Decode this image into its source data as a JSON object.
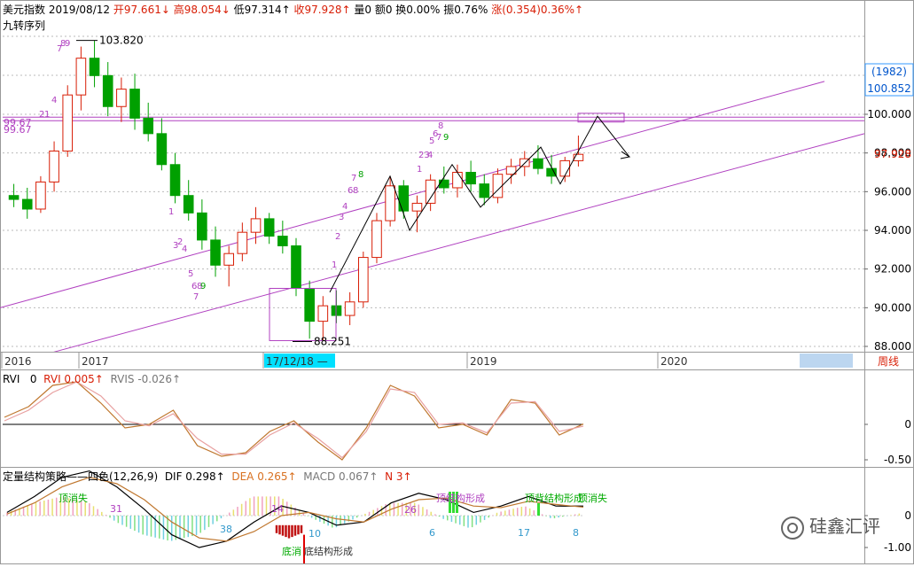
{
  "header": {
    "name": "美元指数",
    "date": "2019/08/12",
    "open": "开97.661↓",
    "high": "高98.054↓",
    "low": "低97.314↑",
    "close": "收97.928↑",
    "volume": "量0",
    "amount": "额0",
    "turnover": "换0.00%",
    "amplitude": "振0.76%",
    "change": "涨(0.354)0.36%↑",
    "indicator_name": "九转序列"
  },
  "price_labels": {
    "y_ticks": [
      "100.000",
      "98.000",
      "96.000",
      "94.000",
      "92.000",
      "90.000",
      "88.000"
    ],
    "badge_top": "(1982)",
    "badge_value": "100.852",
    "current": "97.928",
    "high_marker": "103.820",
    "low_marker": "88.251",
    "left_level": "99.67",
    "left_level_2": "99.67"
  },
  "time_axis": {
    "labels": [
      "2016",
      "2017",
      "17/12/18 —",
      "2019",
      "2020"
    ],
    "period": "周线"
  },
  "td_digits": [
    {
      "t": "8",
      "c": "#b040c0"
    },
    {
      "t": "9",
      "c": "#b040c0"
    },
    {
      "t": "7",
      "c": "#b040c0"
    },
    {
      "t": "4",
      "c": "#b040c0"
    },
    {
      "t": "1",
      "c": "#b040c0"
    },
    {
      "t": "2",
      "c": "#b040c0"
    },
    {
      "t": "1",
      "c": "#b040c0"
    },
    {
      "t": "2",
      "c": "#b040c0"
    },
    {
      "t": "3",
      "c": "#b040c0"
    },
    {
      "t": "4",
      "c": "#b040c0"
    },
    {
      "t": "5",
      "c": "#b040c0"
    },
    {
      "t": "6",
      "c": "#b040c0"
    },
    {
      "t": "8",
      "c": "#b040c0"
    },
    {
      "t": "9",
      "c": "#00a000"
    },
    {
      "t": "7",
      "c": "#b040c0"
    },
    {
      "t": "7",
      "c": "#b040c0"
    },
    {
      "t": "8",
      "c": "#00a000"
    },
    {
      "t": "6",
      "c": "#b040c0"
    },
    {
      "t": "8",
      "c": "#b040c0"
    },
    {
      "t": "4",
      "c": "#b040c0"
    },
    {
      "t": "3",
      "c": "#b040c0"
    },
    {
      "t": "2",
      "c": "#b040c0"
    },
    {
      "t": "1",
      "c": "#b040c0"
    },
    {
      "t": "23",
      "c": "#b040c0"
    },
    {
      "t": "4",
      "c": "#b040c0"
    },
    {
      "t": "1",
      "c": "#b040c0"
    },
    {
      "t": "8",
      "c": "#b040c0"
    },
    {
      "t": "6",
      "c": "#b040c0"
    },
    {
      "t": "5",
      "c": "#b040c0"
    },
    {
      "t": "7",
      "c": "#b040c0"
    },
    {
      "t": "9",
      "c": "#00a000"
    }
  ],
  "rvi_panel": {
    "title": "RVI",
    "zero": "0",
    "rvi": "RVI 0.005↑",
    "rvis": "RVIS -0.026↑",
    "y_ticks": [
      "0",
      "-0.50"
    ]
  },
  "macd_panel": {
    "title": "定量结构策略——四色(12,26,9)",
    "dif": "DIF 0.298↑",
    "dea": "DEA 0.265↑",
    "macd": "MACD 0.067↑",
    "n": "N 3↑",
    "y_ticks": [
      "0",
      "-1.00"
    ],
    "annotations": {
      "top_disappear": "顶消失",
      "top_disappear_2": "顶消失",
      "top_struct": "顶结构形成",
      "top_struct_2": "顶背结构形成",
      "bottom_struct": "底结构形成",
      "bottom_mark": "底消",
      "count_31": "31",
      "count_14": "14",
      "count_26": "26",
      "count_38": "38",
      "count_10": "10",
      "count_6": "6",
      "count_17": "17",
      "count_8": "8"
    }
  },
  "watermark": "硅鑫汇评",
  "colors": {
    "up": "#d81e06",
    "down": "#00a000",
    "channel": "#b040c0",
    "rvi": "#c07830",
    "rvis": "#e8a0a0",
    "axis_highlight": "#00e0ff",
    "dea_line": "#c07830",
    "dif_line": "#000000"
  },
  "chart_data": {
    "type": "candlestick",
    "title": "美元指数",
    "ylim": [
      87.5,
      104.2
    ],
    "x": [
      "2016",
      "2017",
      "2019",
      "2020"
    ],
    "ohlc": [
      [
        95.8,
        96.4,
        95.2,
        95.6
      ],
      [
        95.6,
        96.2,
        94.6,
        95.1
      ],
      [
        95.1,
        96.8,
        94.9,
        96.5
      ],
      [
        96.5,
        98.6,
        96.0,
        98.1
      ],
      [
        98.1,
        101.5,
        97.8,
        101.0
      ],
      [
        101.0,
        103.5,
        100.2,
        102.9
      ],
      [
        102.9,
        103.8,
        101.4,
        102.0
      ],
      [
        102.0,
        102.7,
        99.9,
        100.4
      ],
      [
        100.4,
        101.9,
        99.6,
        101.3
      ],
      [
        101.3,
        102.1,
        99.2,
        99.8
      ],
      [
        99.8,
        100.6,
        98.6,
        99.0
      ],
      [
        99.0,
        99.8,
        97.1,
        97.4
      ],
      [
        97.4,
        98.0,
        95.4,
        95.8
      ],
      [
        95.8,
        96.6,
        94.5,
        94.9
      ],
      [
        94.9,
        95.6,
        93.0,
        93.5
      ],
      [
        93.5,
        94.2,
        91.6,
        92.2
      ],
      [
        92.2,
        93.2,
        91.1,
        92.8
      ],
      [
        92.8,
        94.4,
        92.4,
        93.9
      ],
      [
        93.9,
        95.2,
        93.3,
        94.6
      ],
      [
        94.6,
        94.9,
        93.3,
        93.7
      ],
      [
        93.7,
        94.5,
        92.8,
        93.2
      ],
      [
        93.2,
        93.6,
        90.6,
        91.0
      ],
      [
        91.0,
        91.4,
        88.4,
        89.3
      ],
      [
        89.3,
        90.6,
        88.3,
        90.1
      ],
      [
        90.1,
        90.9,
        89.2,
        89.6
      ],
      [
        89.6,
        90.8,
        89.1,
        90.3
      ],
      [
        90.3,
        92.9,
        90.0,
        92.6
      ],
      [
        92.6,
        94.9,
        92.3,
        94.5
      ],
      [
        94.5,
        96.8,
        94.2,
        96.3
      ],
      [
        96.3,
        96.6,
        94.6,
        95.0
      ],
      [
        95.0,
        95.8,
        93.9,
        95.4
      ],
      [
        95.4,
        96.9,
        95.0,
        96.6
      ],
      [
        96.6,
        97.3,
        95.9,
        96.2
      ],
      [
        96.2,
        97.4,
        95.7,
        97.0
      ],
      [
        97.0,
        97.6,
        96.0,
        96.4
      ],
      [
        96.4,
        96.9,
        95.3,
        95.7
      ],
      [
        95.7,
        97.2,
        95.4,
        96.9
      ],
      [
        96.9,
        97.7,
        96.4,
        97.3
      ],
      [
        97.3,
        98.1,
        96.8,
        97.7
      ],
      [
        97.7,
        98.4,
        96.9,
        97.2
      ],
      [
        97.2,
        97.9,
        96.4,
        96.8
      ],
      [
        96.8,
        97.8,
        96.5,
        97.6
      ],
      [
        97.6,
        98.9,
        97.3,
        97.93
      ]
    ],
    "channels": [
      {
        "name": "",
        "x": [
          0,
          930
        ],
        "y": [
          90.0,
          101.7
        ]
      },
      {
        "name": "",
        "x": [
          60,
          975
        ],
        "y": [
          87.7,
          99.0
        ]
      }
    ],
    "levels": [
      99.67,
      99.85
    ],
    "series": [
      {
        "name": "RVI",
        "values": [
          0.1,
          0.25,
          0.55,
          0.6,
          0.3,
          -0.05,
          0.0,
          0.2,
          -0.3,
          -0.45,
          -0.4,
          -0.1,
          0.05,
          -0.25,
          -0.5,
          -0.05,
          0.55,
          0.4,
          -0.05,
          0.0,
          -0.15,
          0.35,
          0.3,
          -0.15,
          0.005
        ]
      },
      {
        "name": "RVIS",
        "values": [
          0.05,
          0.2,
          0.45,
          0.6,
          0.4,
          0.05,
          -0.02,
          0.15,
          -0.2,
          -0.42,
          -0.42,
          -0.15,
          0.02,
          -0.2,
          -0.47,
          -0.1,
          0.5,
          0.45,
          0.0,
          0.02,
          -0.12,
          0.3,
          0.32,
          -0.1,
          -0.026
        ]
      },
      {
        "name": "DIF",
        "values": [
          0.1,
          0.6,
          1.2,
          1.4,
          0.9,
          0.2,
          -0.6,
          -1.0,
          -0.8,
          -0.2,
          0.3,
          0.1,
          -0.3,
          -0.2,
          0.4,
          0.7,
          0.5,
          0.1,
          0.3,
          0.6,
          0.3,
          0.298
        ]
      },
      {
        "name": "DEA",
        "values": [
          0.05,
          0.4,
          0.9,
          1.2,
          1.0,
          0.5,
          -0.2,
          -0.7,
          -0.8,
          -0.5,
          0.0,
          0.1,
          -0.1,
          -0.2,
          0.2,
          0.5,
          0.55,
          0.3,
          0.25,
          0.45,
          0.35,
          0.265
        ]
      }
    ]
  }
}
